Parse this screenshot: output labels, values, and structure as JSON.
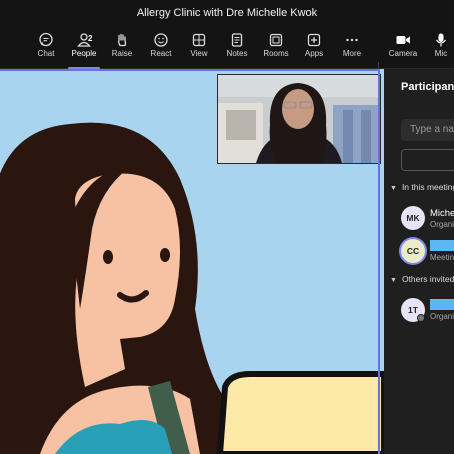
{
  "window": {
    "title": "Allergy Clinic with Dre Michelle Kwok"
  },
  "toolbar": {
    "items": [
      {
        "label": "Chat",
        "icon": "chat-icon"
      },
      {
        "label": "People",
        "icon": "people-icon",
        "count": "2",
        "active": true
      },
      {
        "label": "Raise",
        "icon": "hand-icon"
      },
      {
        "label": "React",
        "icon": "smiley-icon"
      },
      {
        "label": "View",
        "icon": "grid-icon"
      },
      {
        "label": "Notes",
        "icon": "notes-icon"
      },
      {
        "label": "Rooms",
        "icon": "rooms-icon"
      },
      {
        "label": "Apps",
        "icon": "plus-icon"
      },
      {
        "label": "More",
        "icon": "more-icon"
      },
      {
        "label": "Camera",
        "icon": "camera-icon"
      },
      {
        "label": "Mic",
        "icon": "mic-icon"
      }
    ],
    "accent": "#7f85f5"
  },
  "panel": {
    "title": "Participants",
    "search_placeholder": "Type a name",
    "in_meeting_label": "In this meeting",
    "others_label": "Others invited",
    "in_meeting": [
      {
        "initials": "MK",
        "name": "Michelle Kwok",
        "role": "Organizer",
        "avatar_color": "#e8e4f8"
      },
      {
        "initials": "CC",
        "name": "",
        "role": "Meeting guest",
        "avatar_color": "#e9ecc7"
      }
    ],
    "others": [
      {
        "initials": "1T",
        "name": "",
        "role": "Organizer",
        "avatar_color": "#e8e4f8"
      }
    ]
  },
  "colors": {
    "stage_bg": "#a9d4ef",
    "speaking_border": "#6b6fe0",
    "redaction": "#5cb8f5"
  }
}
